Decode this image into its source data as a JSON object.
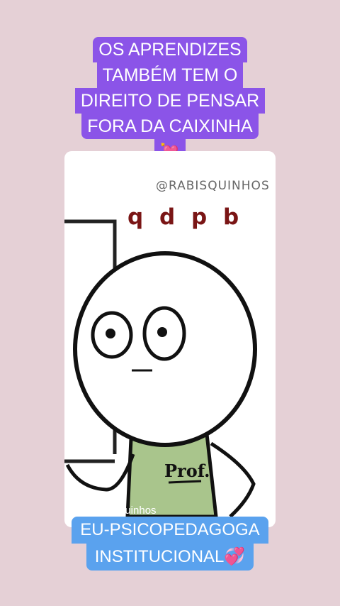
{
  "caption_top": {
    "line1": "OS APRENDIZES",
    "line2": "TAMBÉM TEM O",
    "line3": "DIREITO DE PENSAR",
    "line4": "FORA DA CAIXINHA",
    "emoji": "💘"
  },
  "card": {
    "watermark": "@RABISQUINHOS",
    "letters": "q d p b",
    "shirt_text": "Prof.",
    "bottom_watermark": "quinhos"
  },
  "caption_bottom": {
    "line1": "EU-PSICOPEDAGOGA",
    "line2": "INSTITUCIONAL💞"
  },
  "colors": {
    "background": "#e5d0d6",
    "top_caption": "#8b54e8",
    "bottom_caption": "#5aa2ee",
    "letters": "#7a1515",
    "shirt": "#a9c58c"
  }
}
